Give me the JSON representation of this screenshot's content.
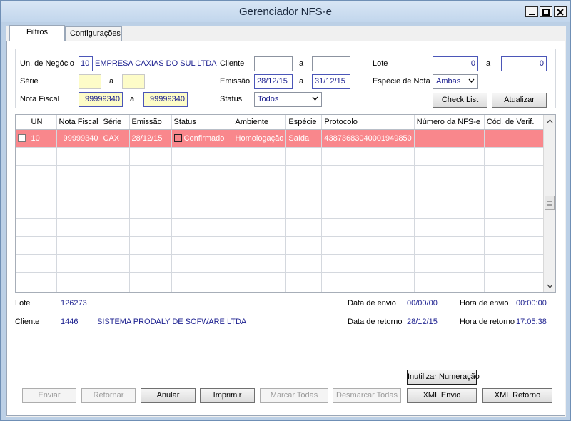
{
  "window": {
    "title": "Gerenciador NFS-e"
  },
  "tabs": [
    "Filtros",
    "Configurações"
  ],
  "filters": {
    "un_negocio_label": "Un. de Negócio",
    "un_negocio_code": "10",
    "un_negocio_name": "EMPRESA CAXIAS DO SUL LTDA",
    "serie_label": "Série",
    "serie_from": "",
    "serie_to": "",
    "nota_fiscal_label": "Nota Fiscal",
    "nota_fiscal_from": "99999340",
    "nota_fiscal_to": "99999340",
    "range_sep": "a",
    "cliente_label": "Cliente",
    "cliente_from": "",
    "cliente_to": "",
    "emissao_label": "Emissão",
    "emissao_from": "28/12/15",
    "emissao_to": "31/12/15",
    "status_label": "Status",
    "status_value": "Todos",
    "lote_label": "Lote",
    "lote_from": "0",
    "lote_to": "0",
    "especie_label": "Espécie de Nota",
    "especie_value": "Ambas",
    "check_list_button": "Check List",
    "atualizar_button": "Atualizar"
  },
  "grid": {
    "columns": [
      "",
      "UN",
      "Nota Fiscal",
      "Série",
      "Emissão",
      "Status",
      "Ambiente",
      "Espécie",
      "Protocolo",
      "Número da NFS-e",
      "Cód. de Verif."
    ],
    "rows": [
      {
        "un": "10",
        "nota_fiscal": "99999340",
        "serie": "CAX",
        "emissao": "28/12/15",
        "status": "Confirmado",
        "ambiente": "Homologação",
        "especie": "Saída",
        "protocolo": "43873683040001949850",
        "numero_nfse": "",
        "cod_verif": ""
      }
    ]
  },
  "details": {
    "lote_label": "Lote",
    "lote_value": "126273",
    "cliente_label": "Cliente",
    "cliente_code": "1446",
    "cliente_name": "SISTEMA PRODALY DE SOFWARE LTDA",
    "data_envio_label": "Data de envio",
    "data_envio_value": "00/00/00",
    "hora_envio_label": "Hora de envio",
    "hora_envio_value": "00:00:00",
    "data_retorno_label": "Data de retorno",
    "data_retorno_value": "28/12/15",
    "hora_retorno_label": "Hora de retorno",
    "hora_retorno_value": "17:05:38"
  },
  "actions": {
    "inutilizar": "Inutilizar Numeração",
    "enviar": "Enviar",
    "retornar": "Retornar",
    "anular": "Anular",
    "imprimir": "Imprimir",
    "marcar_todas": "Marcar Todas",
    "desmarcar_todas": "Desmarcar Todas",
    "xml_envio": "XML Envio",
    "xml_retorno": "XML Retorno"
  },
  "colors": {
    "highlight_row": "#f9878c",
    "value_text": "#1b1f8f"
  }
}
